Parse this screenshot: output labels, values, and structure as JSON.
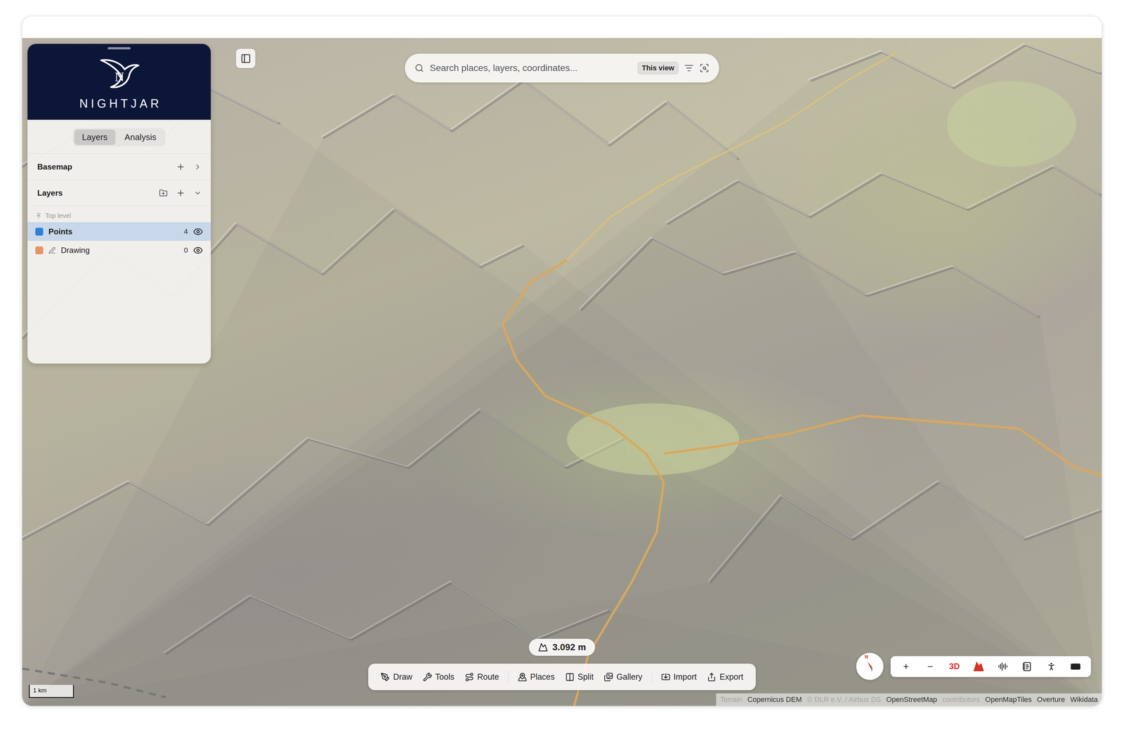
{
  "app": {
    "name": "NIGHTJAR",
    "logo_mark": "N"
  },
  "sidebar": {
    "tabs": [
      {
        "label": "Layers",
        "selected": true
      },
      {
        "label": "Analysis",
        "selected": false
      }
    ],
    "sections": [
      {
        "label": "Basemap",
        "expanded": false
      },
      {
        "label": "Layers",
        "expanded": true
      }
    ],
    "group_label": "Top level",
    "layers": [
      {
        "name": "Points",
        "count": "4",
        "color": "#2f7fd8",
        "selected": true,
        "visible": true,
        "kind": "points"
      },
      {
        "name": "Drawing",
        "count": "0",
        "color": "#ea9266",
        "selected": false,
        "visible": true,
        "kind": "drawing"
      }
    ]
  },
  "search": {
    "placeholder": "Search places, layers, coordinates...",
    "scope": "This view"
  },
  "elevation": "3.092 m",
  "toolbar": [
    {
      "label": "Draw",
      "group": 1
    },
    {
      "label": "Tools",
      "group": 1
    },
    {
      "label": "Route",
      "group": 1
    },
    {
      "label": "Places",
      "group": 2
    },
    {
      "label": "Split",
      "group": 2
    },
    {
      "label": "Gallery",
      "group": 2
    },
    {
      "label": "Import",
      "group": 3
    },
    {
      "label": "Export",
      "group": 3
    }
  ],
  "map_controls": {
    "compass": "N",
    "zoom_in": "+",
    "zoom_out": "−",
    "mode": "3D",
    "three_d_on": true,
    "terrain_on": true
  },
  "scale": {
    "label": "1 km"
  },
  "attribution": [
    {
      "text": "Terrain",
      "faded": true
    },
    {
      "text": "Copernicus DEM",
      "faded": false
    },
    {
      "text": "© DLR e.V. / Airbus DS",
      "faded": true
    },
    {
      "text": "OpenStreetMap",
      "faded": false
    },
    {
      "text": "contributors",
      "faded": true
    },
    {
      "text": "OpenMapTiles",
      "faded": false
    },
    {
      "text": "Overture",
      "faded": false
    },
    {
      "text": "Wikidata",
      "faded": false
    }
  ]
}
